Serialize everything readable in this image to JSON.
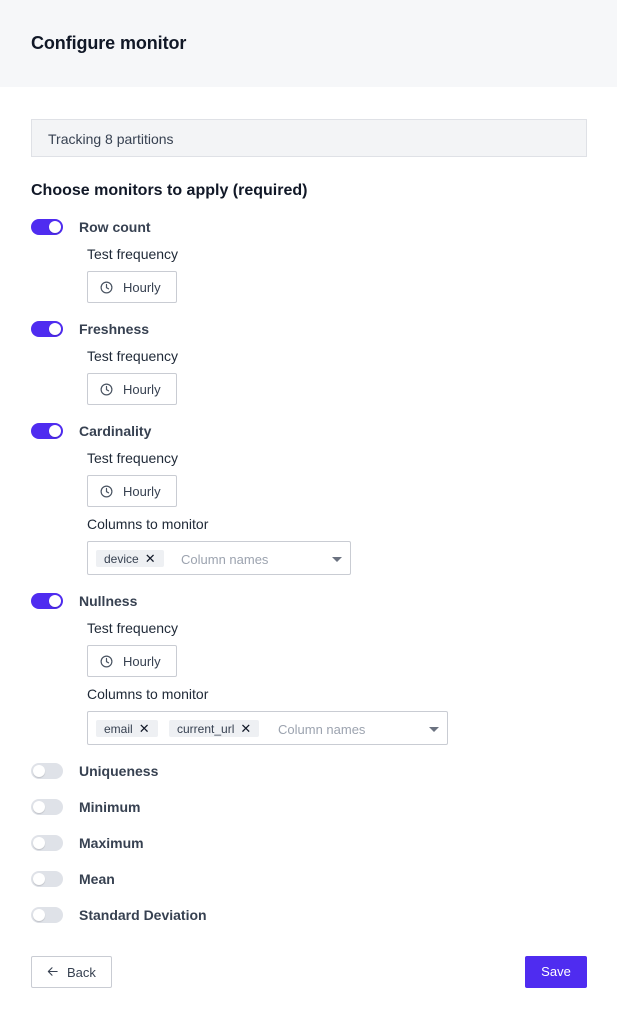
{
  "header": {
    "title": "Configure monitor"
  },
  "banner": {
    "text": "Tracking 8 partitions"
  },
  "section": {
    "title": "Choose monitors to apply (required)"
  },
  "labels": {
    "test_frequency": "Test frequency",
    "columns_to_monitor": "Columns to monitor"
  },
  "monitors": [
    {
      "label": "Row count",
      "enabled": true,
      "frequency": "Hourly"
    },
    {
      "label": "Freshness",
      "enabled": true,
      "frequency": "Hourly"
    },
    {
      "label": "Cardinality",
      "enabled": true,
      "frequency": "Hourly",
      "columns": {
        "tags": [
          "device"
        ],
        "placeholder": "Column names"
      }
    },
    {
      "label": "Nullness",
      "enabled": true,
      "frequency": "Hourly",
      "columns": {
        "tags": [
          "email",
          "current_url"
        ],
        "placeholder": "Column names"
      }
    },
    {
      "label": "Uniqueness",
      "enabled": false
    },
    {
      "label": "Minimum",
      "enabled": false
    },
    {
      "label": "Maximum",
      "enabled": false
    },
    {
      "label": "Mean",
      "enabled": false
    },
    {
      "label": "Standard Deviation",
      "enabled": false
    }
  ],
  "tag_remove_glyph": "✕",
  "footer": {
    "back_label": "Back",
    "save_label": "Save"
  },
  "colors": {
    "accent": "#4f2cf0",
    "toggle_off": "#dfe2e8",
    "header_bg": "#f6f7f9"
  },
  "icons": {
    "frequency": "clock-icon",
    "back": "arrow-left-icon",
    "select": "caret-down-icon"
  }
}
